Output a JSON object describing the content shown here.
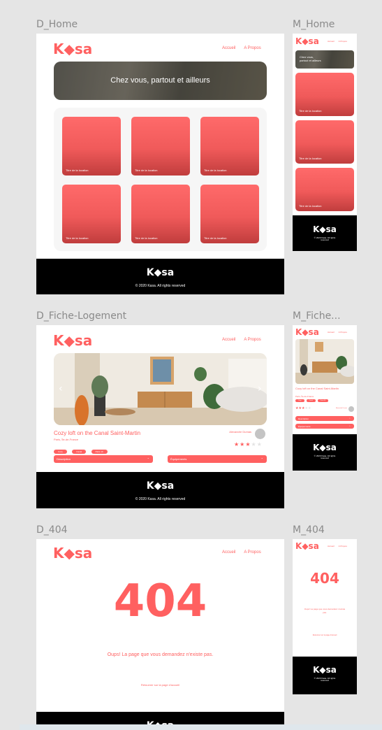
{
  "frames": {
    "d_home": "D_Home",
    "m_home": "M_Home",
    "d_fiche": "D_Fiche-Logement",
    "m_fiche": "M_Fiche...",
    "d_404": "D_404",
    "m_404": "M_404"
  },
  "brand": {
    "logo_before": "K",
    "logo_after": "sa",
    "color_accent": "#ff6060",
    "color_dark": "#000000"
  },
  "nav": {
    "home": "Accueil",
    "about": "A Propos"
  },
  "home": {
    "banner": "Chez vous, partout et ailleurs",
    "banner_mobile": "Chez vous,\npartout et ailleurs",
    "cards": [
      "Titre de la location",
      "Titre de la location",
      "Titre de la location",
      "Titre de la location",
      "Titre de la location",
      "Titre de la location"
    ]
  },
  "footer": {
    "copyright": "© 2020 Kasa. All rights reserved"
  },
  "fiche": {
    "title": "Cozy loft on the Canal Saint-Martin",
    "location": "Paris, Île-de-France",
    "tags": [
      "Cozy",
      "Canal",
      "Paris 10"
    ],
    "host_name": "Alexandre Dumas",
    "rating": 3,
    "rating_max": 5,
    "description": "Description",
    "equipments": "Équipements"
  },
  "error": {
    "code": "404",
    "message": "Oups! La page que vous demandez n'existe pas.",
    "link": "Retourner sur la page d'accueil"
  }
}
